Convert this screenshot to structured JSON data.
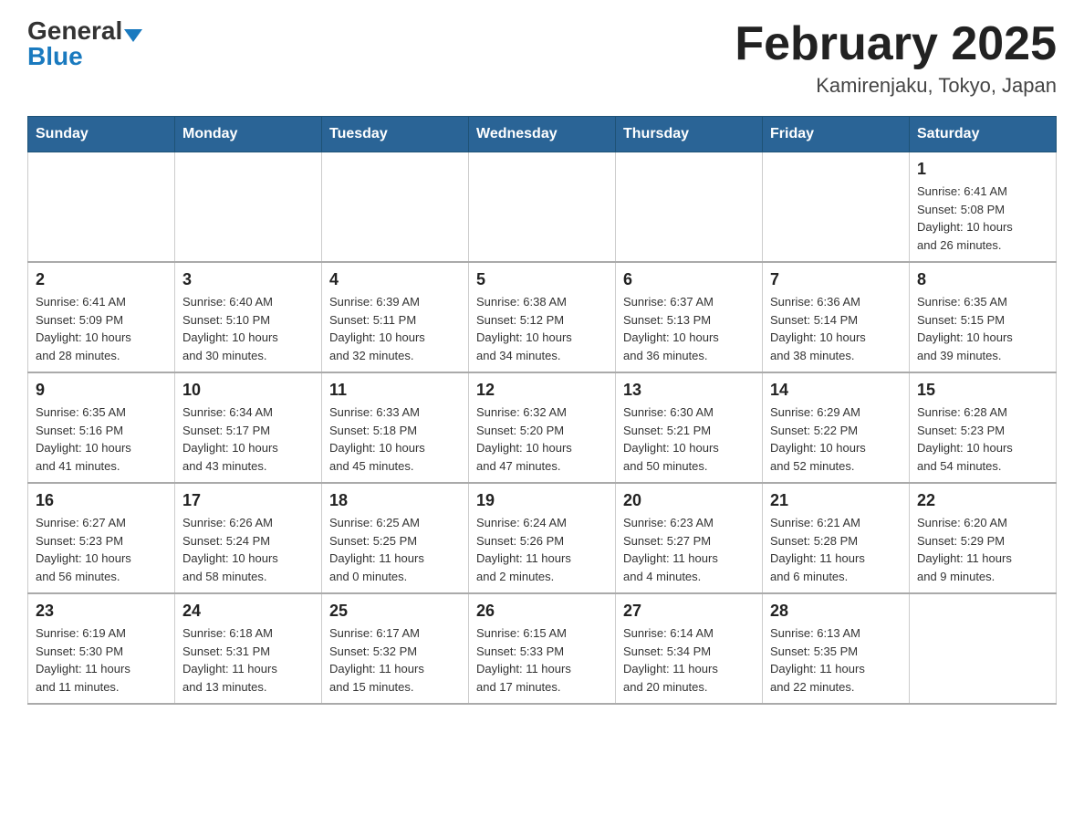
{
  "header": {
    "logo": {
      "general": "General",
      "blue": "Blue",
      "tagline": "GeneralBlue"
    },
    "title": "February 2025",
    "location": "Kamirenjaku, Tokyo, Japan"
  },
  "weekdays": [
    "Sunday",
    "Monday",
    "Tuesday",
    "Wednesday",
    "Thursday",
    "Friday",
    "Saturday"
  ],
  "weeks": [
    [
      {
        "day": "",
        "info": ""
      },
      {
        "day": "",
        "info": ""
      },
      {
        "day": "",
        "info": ""
      },
      {
        "day": "",
        "info": ""
      },
      {
        "day": "",
        "info": ""
      },
      {
        "day": "",
        "info": ""
      },
      {
        "day": "1",
        "info": "Sunrise: 6:41 AM\nSunset: 5:08 PM\nDaylight: 10 hours\nand 26 minutes."
      }
    ],
    [
      {
        "day": "2",
        "info": "Sunrise: 6:41 AM\nSunset: 5:09 PM\nDaylight: 10 hours\nand 28 minutes."
      },
      {
        "day": "3",
        "info": "Sunrise: 6:40 AM\nSunset: 5:10 PM\nDaylight: 10 hours\nand 30 minutes."
      },
      {
        "day": "4",
        "info": "Sunrise: 6:39 AM\nSunset: 5:11 PM\nDaylight: 10 hours\nand 32 minutes."
      },
      {
        "day": "5",
        "info": "Sunrise: 6:38 AM\nSunset: 5:12 PM\nDaylight: 10 hours\nand 34 minutes."
      },
      {
        "day": "6",
        "info": "Sunrise: 6:37 AM\nSunset: 5:13 PM\nDaylight: 10 hours\nand 36 minutes."
      },
      {
        "day": "7",
        "info": "Sunrise: 6:36 AM\nSunset: 5:14 PM\nDaylight: 10 hours\nand 38 minutes."
      },
      {
        "day": "8",
        "info": "Sunrise: 6:35 AM\nSunset: 5:15 PM\nDaylight: 10 hours\nand 39 minutes."
      }
    ],
    [
      {
        "day": "9",
        "info": "Sunrise: 6:35 AM\nSunset: 5:16 PM\nDaylight: 10 hours\nand 41 minutes."
      },
      {
        "day": "10",
        "info": "Sunrise: 6:34 AM\nSunset: 5:17 PM\nDaylight: 10 hours\nand 43 minutes."
      },
      {
        "day": "11",
        "info": "Sunrise: 6:33 AM\nSunset: 5:18 PM\nDaylight: 10 hours\nand 45 minutes."
      },
      {
        "day": "12",
        "info": "Sunrise: 6:32 AM\nSunset: 5:20 PM\nDaylight: 10 hours\nand 47 minutes."
      },
      {
        "day": "13",
        "info": "Sunrise: 6:30 AM\nSunset: 5:21 PM\nDaylight: 10 hours\nand 50 minutes."
      },
      {
        "day": "14",
        "info": "Sunrise: 6:29 AM\nSunset: 5:22 PM\nDaylight: 10 hours\nand 52 minutes."
      },
      {
        "day": "15",
        "info": "Sunrise: 6:28 AM\nSunset: 5:23 PM\nDaylight: 10 hours\nand 54 minutes."
      }
    ],
    [
      {
        "day": "16",
        "info": "Sunrise: 6:27 AM\nSunset: 5:23 PM\nDaylight: 10 hours\nand 56 minutes."
      },
      {
        "day": "17",
        "info": "Sunrise: 6:26 AM\nSunset: 5:24 PM\nDaylight: 10 hours\nand 58 minutes."
      },
      {
        "day": "18",
        "info": "Sunrise: 6:25 AM\nSunset: 5:25 PM\nDaylight: 11 hours\nand 0 minutes."
      },
      {
        "day": "19",
        "info": "Sunrise: 6:24 AM\nSunset: 5:26 PM\nDaylight: 11 hours\nand 2 minutes."
      },
      {
        "day": "20",
        "info": "Sunrise: 6:23 AM\nSunset: 5:27 PM\nDaylight: 11 hours\nand 4 minutes."
      },
      {
        "day": "21",
        "info": "Sunrise: 6:21 AM\nSunset: 5:28 PM\nDaylight: 11 hours\nand 6 minutes."
      },
      {
        "day": "22",
        "info": "Sunrise: 6:20 AM\nSunset: 5:29 PM\nDaylight: 11 hours\nand 9 minutes."
      }
    ],
    [
      {
        "day": "23",
        "info": "Sunrise: 6:19 AM\nSunset: 5:30 PM\nDaylight: 11 hours\nand 11 minutes."
      },
      {
        "day": "24",
        "info": "Sunrise: 6:18 AM\nSunset: 5:31 PM\nDaylight: 11 hours\nand 13 minutes."
      },
      {
        "day": "25",
        "info": "Sunrise: 6:17 AM\nSunset: 5:32 PM\nDaylight: 11 hours\nand 15 minutes."
      },
      {
        "day": "26",
        "info": "Sunrise: 6:15 AM\nSunset: 5:33 PM\nDaylight: 11 hours\nand 17 minutes."
      },
      {
        "day": "27",
        "info": "Sunrise: 6:14 AM\nSunset: 5:34 PM\nDaylight: 11 hours\nand 20 minutes."
      },
      {
        "day": "28",
        "info": "Sunrise: 6:13 AM\nSunset: 5:35 PM\nDaylight: 11 hours\nand 22 minutes."
      },
      {
        "day": "",
        "info": ""
      }
    ]
  ]
}
